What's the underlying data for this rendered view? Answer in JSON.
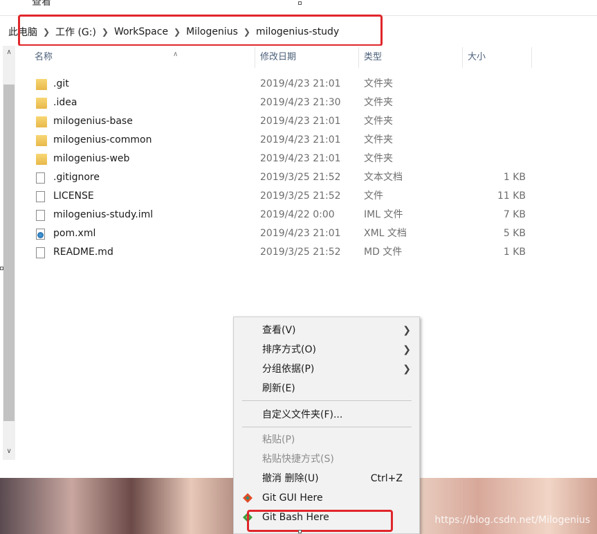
{
  "window": {
    "top_text": "查看"
  },
  "address_bar": {
    "crumbs": [
      "此电脑",
      "工作 (G:)",
      "WorkSpace",
      "Milogenius",
      "milogenius-study"
    ]
  },
  "columns": {
    "name": "名称",
    "date": "修改日期",
    "type": "类型",
    "size": "大小"
  },
  "files": [
    {
      "name": ".git",
      "date": "2019/4/23 21:01",
      "type": "文件夹",
      "size": "",
      "icon": "folder-icon"
    },
    {
      "name": ".idea",
      "date": "2019/4/23 21:30",
      "type": "文件夹",
      "size": "",
      "icon": "folder-icon"
    },
    {
      "name": "milogenius-base",
      "date": "2019/4/23 21:01",
      "type": "文件夹",
      "size": "",
      "icon": "folder-icon"
    },
    {
      "name": "milogenius-common",
      "date": "2019/4/23 21:01",
      "type": "文件夹",
      "size": "",
      "icon": "folder-icon"
    },
    {
      "name": "milogenius-web",
      "date": "2019/4/23 21:01",
      "type": "文件夹",
      "size": "",
      "icon": "folder-icon"
    },
    {
      "name": ".gitignore",
      "date": "2019/3/25 21:52",
      "type": "文本文档",
      "size": "1 KB",
      "icon": "text-file-icon"
    },
    {
      "name": "LICENSE",
      "date": "2019/3/25 21:52",
      "type": "文件",
      "size": "11 KB",
      "icon": "file-icon"
    },
    {
      "name": "milogenius-study.iml",
      "date": "2019/4/22 0:00",
      "type": "IML 文件",
      "size": "7 KB",
      "icon": "file-icon"
    },
    {
      "name": "pom.xml",
      "date": "2019/4/23 21:01",
      "type": "XML 文档",
      "size": "5 KB",
      "icon": "xml-file-icon"
    },
    {
      "name": "README.md",
      "date": "2019/3/25 21:52",
      "type": "MD 文件",
      "size": "1 KB",
      "icon": "file-icon"
    }
  ],
  "context_menu": {
    "view": "查看(V)",
    "sort": "排序方式(O)",
    "group": "分组依据(P)",
    "refresh": "刷新(E)",
    "customize": "自定义文件夹(F)...",
    "paste": "粘贴(P)",
    "paste_shortcut": "粘贴快捷方式(S)",
    "undo": "撤消 删除(U)",
    "undo_shortcut": "Ctrl+Z",
    "git_gui": "Git GUI Here",
    "git_bash": "Git Bash Here"
  },
  "watermark": "https://blog.csdn.net/Milogenius",
  "colors": {
    "highlight_box": "#e0262b",
    "header_text": "#4c607a",
    "folder": "#f0c75e"
  }
}
